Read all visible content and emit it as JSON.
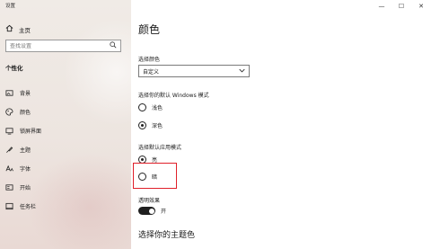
{
  "window": {
    "title": "设置",
    "minimize": "—",
    "maximize": "☐",
    "close": "✕"
  },
  "sidebar": {
    "home_label": "主页",
    "search": {
      "placeholder": "查找设置"
    },
    "section_title": "个性化",
    "items": [
      {
        "label": "背景",
        "icon": "image-icon"
      },
      {
        "label": "颜色",
        "icon": "palette-icon"
      },
      {
        "label": "锁屏界面",
        "icon": "lock-screen-icon"
      },
      {
        "label": "主题",
        "icon": "theme-icon"
      },
      {
        "label": "字体",
        "icon": "font-icon"
      },
      {
        "label": "开始",
        "icon": "start-icon"
      },
      {
        "label": "任务栏",
        "icon": "taskbar-icon"
      }
    ]
  },
  "main": {
    "title": "颜色",
    "choose_color": {
      "label": "选择颜色",
      "value": "自定义"
    },
    "windows_mode": {
      "label": "选择你的默认 Windows 模式",
      "options": [
        {
          "label": "浅色",
          "checked": false
        },
        {
          "label": "深色",
          "checked": true
        }
      ]
    },
    "app_mode": {
      "label": "选择默认应用模式",
      "options": [
        {
          "label": "亮",
          "checked": true
        },
        {
          "label": "暗",
          "checked": false
        }
      ]
    },
    "transparency": {
      "label": "透明效果",
      "state": "开"
    },
    "accent_heading": "选择你的主题色"
  },
  "colors": {
    "highlight_border": "#e0202a",
    "toggle_on": "#1f1f1f"
  }
}
